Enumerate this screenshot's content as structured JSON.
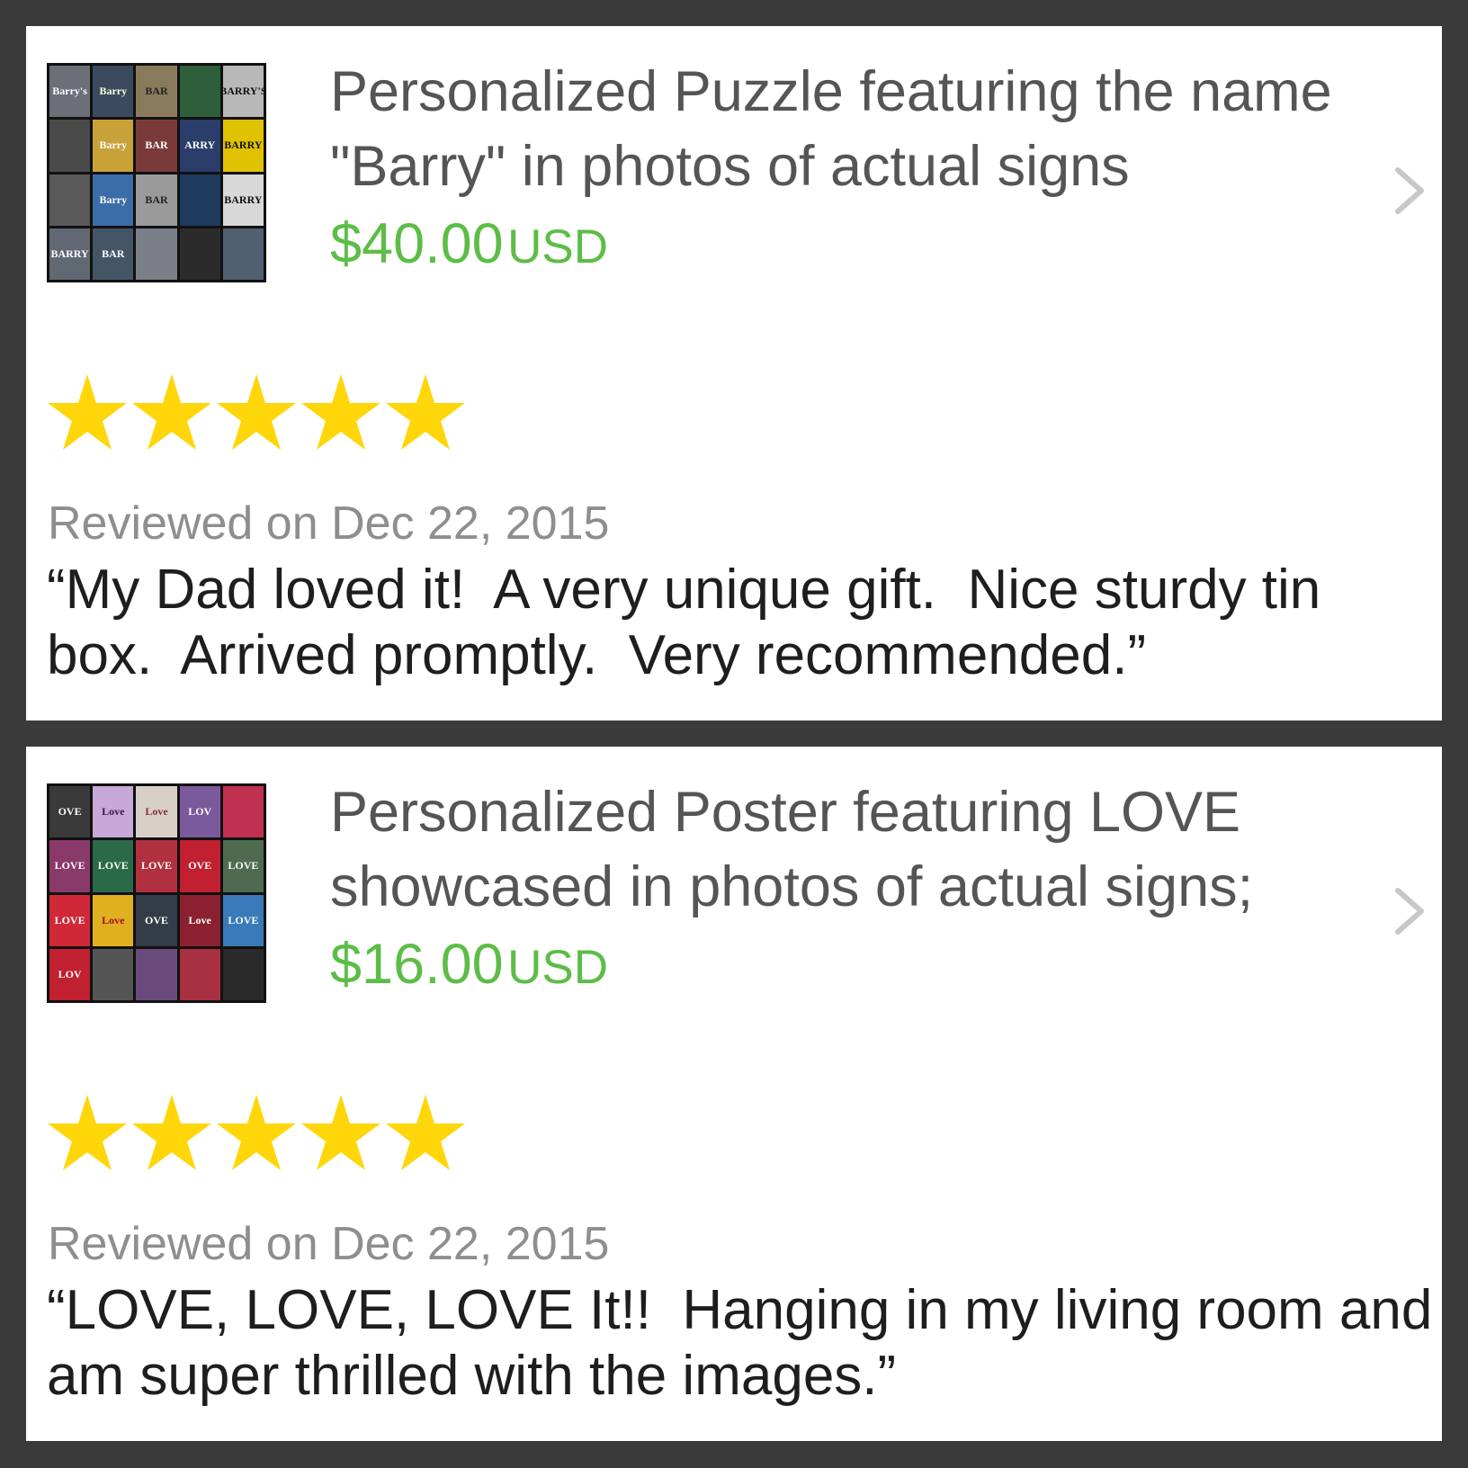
{
  "reviews": [
    {
      "product": {
        "title": "Personalized Puzzle featuring the name \"Barry\" in photos of actual signs",
        "price": "$40.00",
        "currency": "USD",
        "thumbnail_icon": "barry-sign-collage",
        "tiles": [
          "Barry's",
          "Barry",
          "BAR",
          "",
          "BARRY'S",
          "",
          "Barry",
          "BAR",
          "ARRY",
          "BARRY",
          "",
          "Barry",
          "BAR",
          "",
          "BARRY",
          "BARRY",
          "BAR",
          "",
          "",
          ""
        ]
      },
      "rating": 5,
      "date": "Reviewed on Dec 22, 2015",
      "text": "“My Dad loved it!  A very unique gift.  Nice sturdy tin box.  Arrived promptly.  Very recommended.”"
    },
    {
      "product": {
        "title": "Personalized Poster featuring LOVE showcased in photos of actual signs;",
        "price": "$16.00",
        "currency": "USD",
        "thumbnail_icon": "love-sign-collage",
        "tiles": [
          "OVE",
          "Love",
          "Love",
          "LOV",
          "",
          "LOVE",
          "LOVE",
          "LOVE",
          "OVE",
          "LOVE",
          "LOVE",
          "Love",
          "OVE",
          "Love",
          "LOVE",
          "LOV",
          "",
          "",
          "",
          ""
        ]
      },
      "rating": 5,
      "date": "Reviewed on Dec 22, 2015",
      "text": "“LOVE, LOVE, LOVE It!!  Hanging in my living room and am super thrilled with the images.”"
    }
  ],
  "colors": {
    "background": "#3a3a3a",
    "card": "#ffffff",
    "price": "#5cbd47",
    "star": "#ffd60a",
    "title_text": "#555555",
    "date_text": "#8e8e8e",
    "review_text": "#1e1e1e",
    "chevron": "#c7c7cc"
  },
  "icons": {
    "star": "star-icon",
    "chevron": "chevron-right-icon"
  }
}
